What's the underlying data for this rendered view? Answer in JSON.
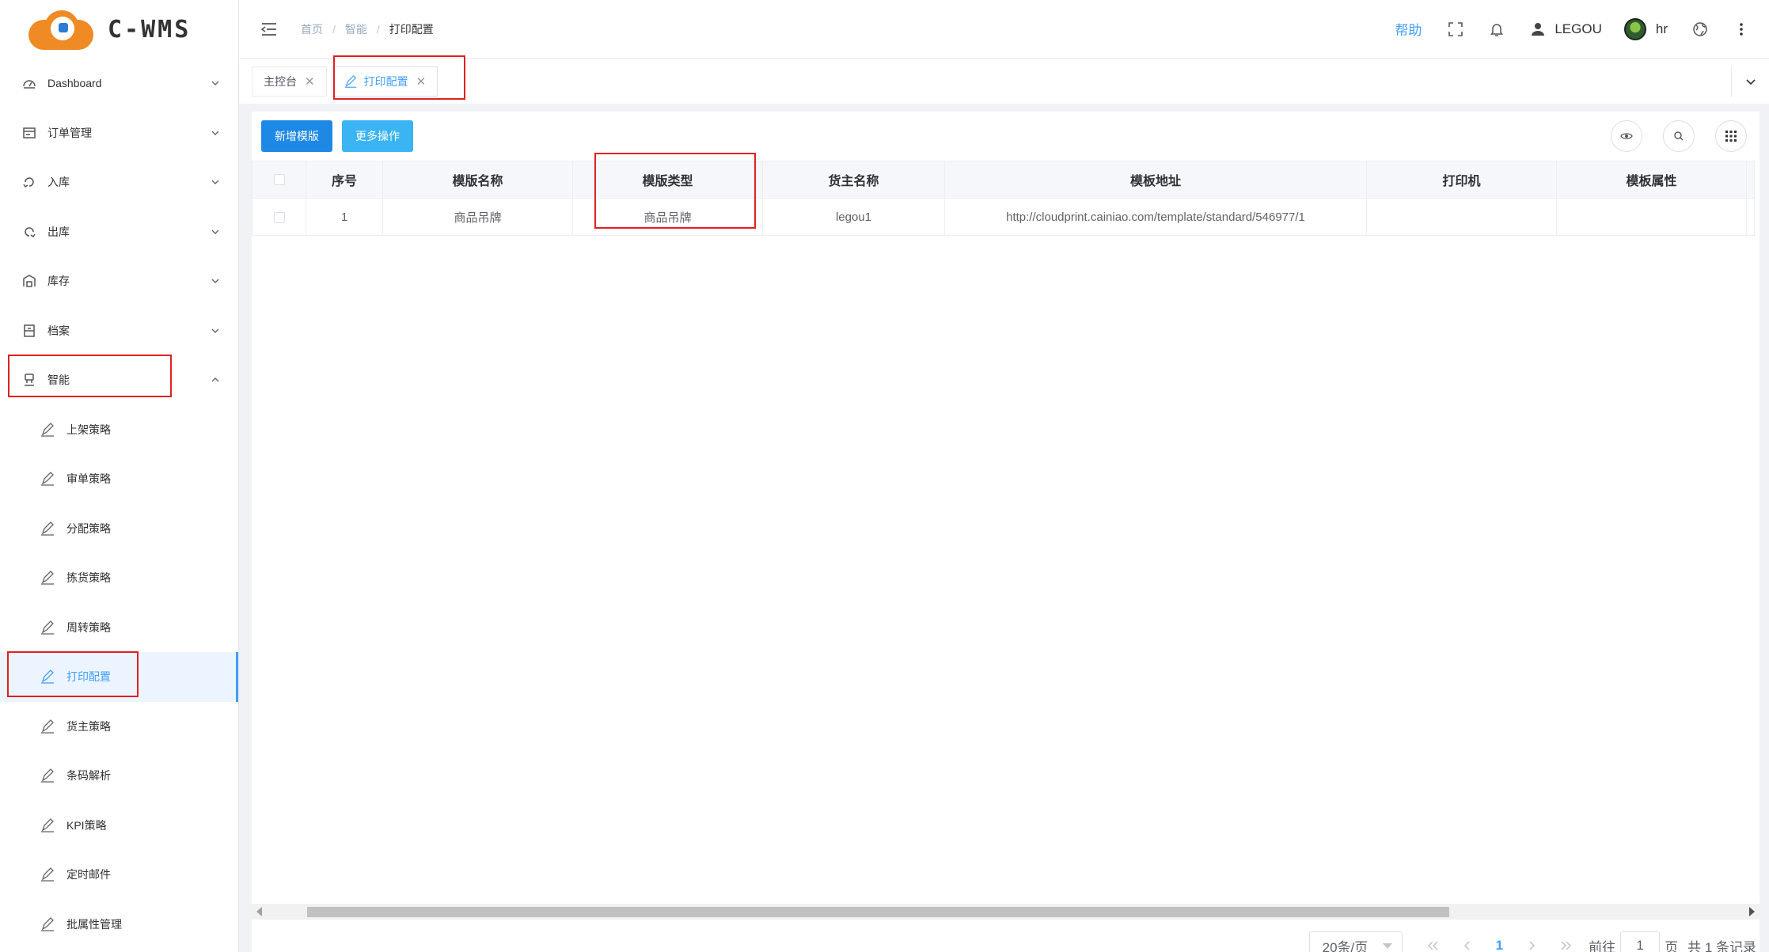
{
  "app": {
    "logo_text": "C-WMS"
  },
  "header": {
    "breadcrumb": [
      "首页",
      "智能",
      "打印配置"
    ],
    "help_label": "帮助",
    "user_label": "LEGOU",
    "profile_label": "hr"
  },
  "sidebar": {
    "menu": [
      {
        "label": "Dashboard",
        "icon": "dashboard-icon"
      },
      {
        "label": "订单管理",
        "icon": "order-icon"
      },
      {
        "label": "入库",
        "icon": "inbound-icon"
      },
      {
        "label": "出库",
        "icon": "outbound-icon"
      },
      {
        "label": "库存",
        "icon": "inventory-icon"
      },
      {
        "label": "档案",
        "icon": "archive-icon"
      },
      {
        "label": "智能",
        "icon": "smart-icon"
      }
    ],
    "submenu": [
      {
        "label": "上架策略"
      },
      {
        "label": "审单策略"
      },
      {
        "label": "分配策略"
      },
      {
        "label": "拣货策略"
      },
      {
        "label": "周转策略"
      },
      {
        "label": "打印配置",
        "active": true
      },
      {
        "label": "货主策略"
      },
      {
        "label": "条码解析"
      },
      {
        "label": "KPI策略"
      },
      {
        "label": "定时邮件"
      },
      {
        "label": "批属性管理"
      }
    ]
  },
  "tabs": [
    {
      "label": "主控台"
    },
    {
      "label": "打印配置",
      "active": true
    }
  ],
  "toolbar": {
    "add_label": "新增模版",
    "more_label": "更多操作"
  },
  "table": {
    "headers": [
      "序号",
      "模版名称",
      "模版类型",
      "货主名称",
      "模板地址",
      "打印机",
      "模板属性"
    ],
    "rows": [
      [
        "1",
        "商品吊牌",
        "商品吊牌",
        "legou1",
        "http://cloudprint.cainiao.com/template/standard/546977/1",
        "",
        ""
      ]
    ]
  },
  "pagination": {
    "page_size": "20条/页",
    "current_page": "1",
    "goto_prefix": "前往",
    "goto_value": "1",
    "goto_suffix": "页",
    "total_text": "共 1 条记录"
  },
  "colors": {
    "accent": "#409eff",
    "primary_button": "#1e88e5",
    "info_button": "#3ab4f2",
    "highlight_box": "#e02020",
    "logo": "#f08a24"
  }
}
